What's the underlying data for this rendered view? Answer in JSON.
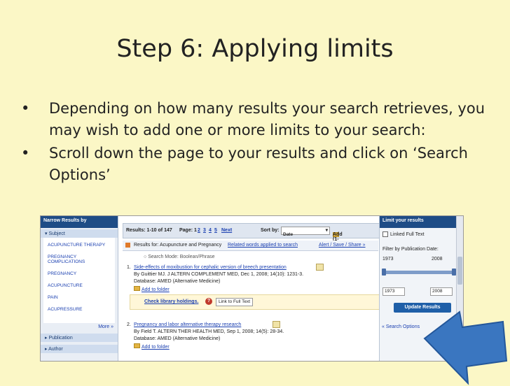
{
  "slide": {
    "title": "Step 6: Applying limits",
    "bullet_char": "•",
    "bullets": [
      "Depending on how many results your search retrieves, you may wish to add one or more limits to your search:",
      "Scroll down the page to your results and click on ‘Search Options’"
    ]
  },
  "screenshot": {
    "left": {
      "header": "Narrow Results by",
      "subject_header": "Subject",
      "subjects": [
        "ACUPUNCTURE THERAPY",
        "PREGNANCY COMPLICATIONS",
        "PREGNANCY",
        "ACUPUNCTURE",
        "PAIN",
        "ACUPRESSURE"
      ],
      "more": "More »",
      "publication": "Publication",
      "author": "Author"
    },
    "mid": {
      "results": "Results: 1-10 of 147",
      "page": "Page: 1",
      "pages": [
        "2",
        "3",
        "4",
        "5"
      ],
      "next": "Next",
      "sort_by": "Sort by:",
      "sort_value": "Date",
      "add_label": "Add (1-10)",
      "results_for": "Results for: Acupuncture and Pregnancy",
      "related": "Related words applied to search",
      "alert": "Alert / Save / Share »",
      "search_mode": "Search Mode: Boolean/Phrase",
      "records": [
        {
          "num": "1.",
          "title": "Side-effects of moxibustion for cephalic version of breech presentation",
          "byline": "By Guittier MJ. J ALTERN COMPLEMENT MED, Dec 1, 2008; 14(10): 1231-3.",
          "database": "Database: AMED (Alternative Medicine)",
          "add_folder": "Add to folder",
          "holdings": "Check library holdings.",
          "fulltext": "Link to Full Text"
        },
        {
          "num": "2.",
          "title": "Pregnancy and labor alternative therapy research",
          "byline": "By Field T. ALTERN THER HEALTH MED, Sep 1, 2008; 14(5): 28-34.",
          "database": "Database: AMED (Alternative Medicine)",
          "add_folder": "Add to folder"
        }
      ]
    },
    "right": {
      "header": "Limit your results",
      "linked_full_text": "Linked Full Text",
      "filter_label": "Filter by Publication Date:",
      "from_year": "1973",
      "to_year": "2008",
      "input_from": "1973",
      "input_to": "2008",
      "update_button": "Update Results",
      "search_options": "« Search Options"
    }
  },
  "colors": {
    "slide_bg": "#fbf7c6",
    "panel_header": "#1e4c86",
    "link": "#1a3fb0",
    "arrow": "#3a76c0"
  }
}
